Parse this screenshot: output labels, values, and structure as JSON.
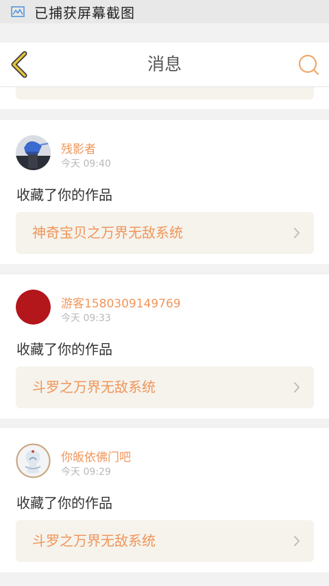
{
  "status_bar": {
    "text": "已捕获屏幕截图",
    "icon": "image-icon"
  },
  "header": {
    "title": "消息",
    "back_icon": "chevron-left-icon",
    "search_icon": "search-icon"
  },
  "colors": {
    "accent": "#f0955a",
    "back_icon": "#e8c33b",
    "work_bg": "#f5f3ec",
    "background": "#f2f2f2"
  },
  "messages": [
    {
      "user": "残影者",
      "time": "今天 09:40",
      "action": "收藏了你的作品",
      "work_title": "神奇宝贝之万界无敌系统"
    },
    {
      "user": "游客1580309149769",
      "time": "今天 09:33",
      "action": "收藏了你的作品",
      "work_title": "斗罗之万界无敌系统"
    },
    {
      "user": "你皈依佛门吧",
      "time": "今天 09:29",
      "action": "收藏了你的作品",
      "work_title": "斗罗之万界无敌系统"
    }
  ]
}
